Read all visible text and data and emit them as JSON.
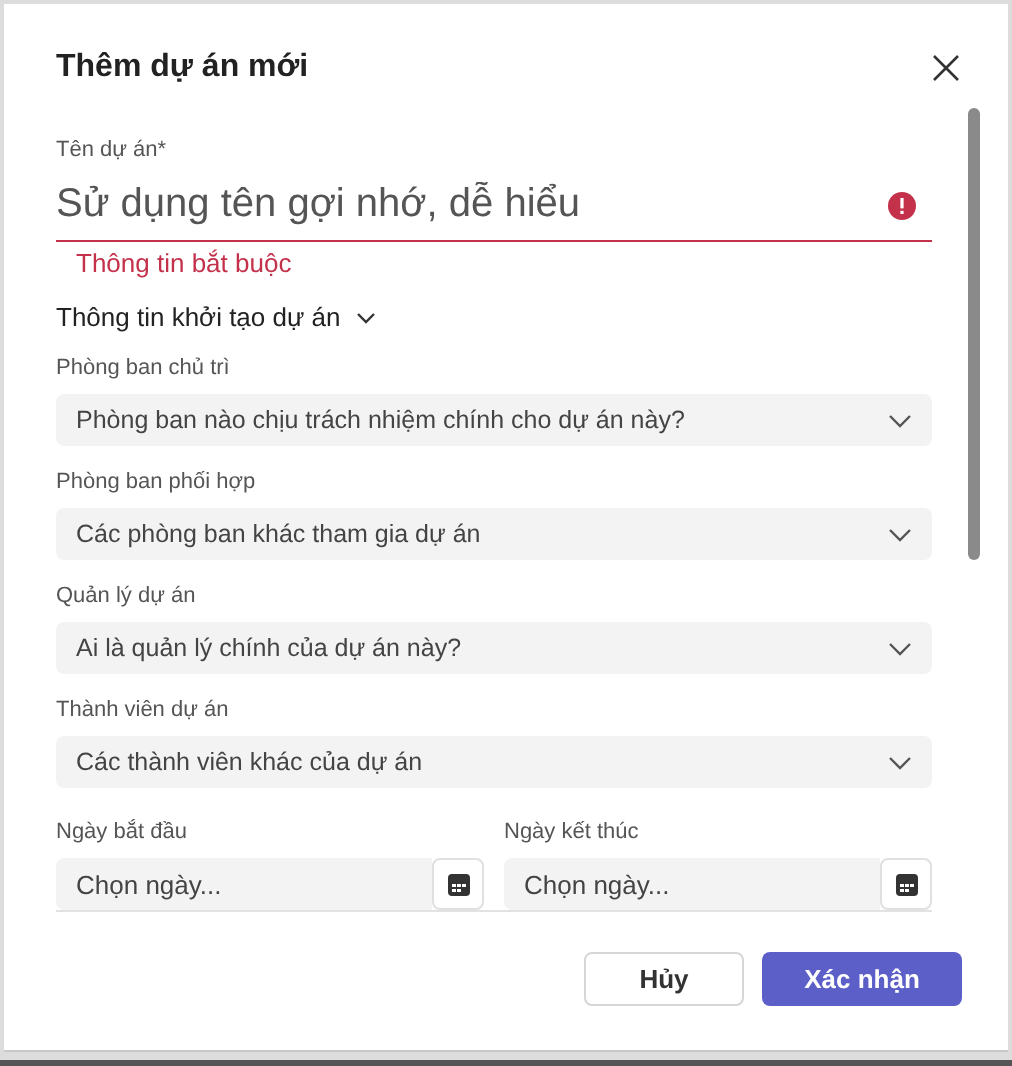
{
  "dialog": {
    "title": "Thêm dự án mới"
  },
  "name_field": {
    "label": "Tên dự án*",
    "placeholder": "Sử dụng tên gợi nhớ, dễ hiểu",
    "error": true,
    "error_message": "Thông tin bắt buộc"
  },
  "section": {
    "title": "Thông tin khởi tạo dự án",
    "expanded": true
  },
  "dropdowns": [
    {
      "label": "Phòng ban chủ trì",
      "placeholder": "Phòng ban nào chịu trách nhiệm chính cho dự án này?"
    },
    {
      "label": "Phòng ban phối hợp",
      "placeholder": "Các phòng ban khác tham gia dự án"
    },
    {
      "label": "Quản lý dự án",
      "placeholder": "Ai là quản lý chính của dự án này?"
    },
    {
      "label": "Thành viên dự án",
      "placeholder": "Các thành viên khác của dự án"
    }
  ],
  "date_fields": [
    {
      "label": "Ngày bắt đầu",
      "placeholder": "Chọn ngày..."
    },
    {
      "label": "Ngày kết thúc",
      "placeholder": "Chọn ngày..."
    }
  ],
  "buttons": [
    {
      "label": "Hủy",
      "kind": "secondary"
    },
    {
      "label": "Xác nhận",
      "kind": "primary"
    }
  ]
}
